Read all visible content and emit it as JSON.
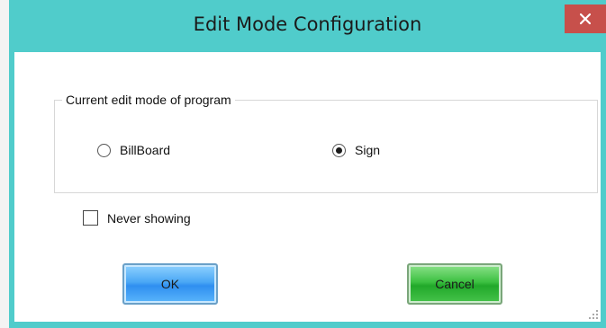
{
  "window": {
    "title": "Edit Mode Configuration",
    "close_glyph": "×"
  },
  "group": {
    "legend": "Current edit mode of program",
    "options": [
      {
        "label": "BillBoard",
        "selected": false
      },
      {
        "label": "Sign",
        "selected": true
      }
    ]
  },
  "never_showing": {
    "label": "Never showing",
    "checked": false
  },
  "buttons": {
    "ok_label": "OK",
    "cancel_label": "Cancel"
  },
  "colors": {
    "titlebar": "#50cccb",
    "close": "#c7504b",
    "ok": "#3a9cf2",
    "cancel": "#2db535"
  }
}
